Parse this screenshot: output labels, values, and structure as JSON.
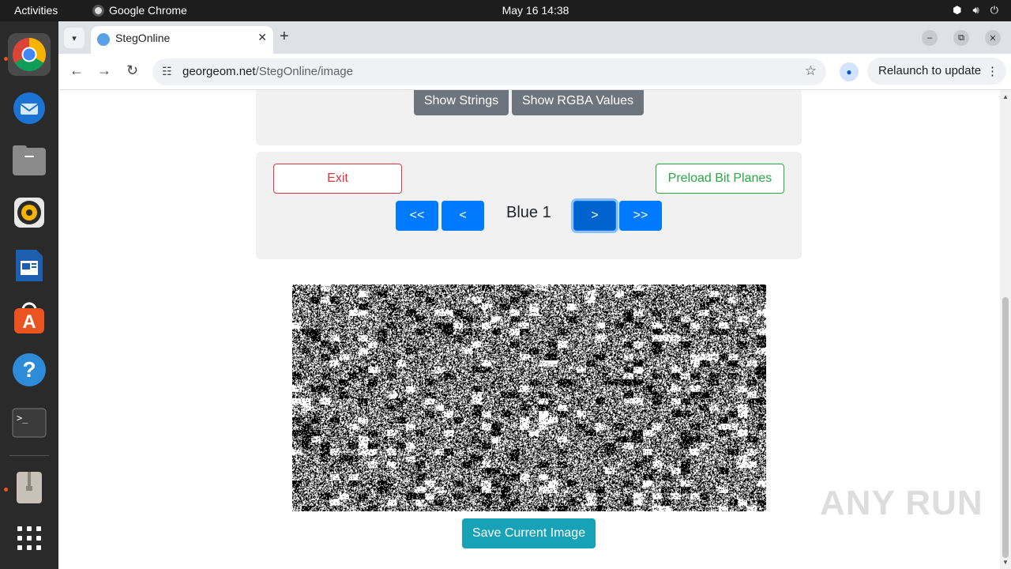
{
  "system": {
    "activities": "Activities",
    "app_name": "Google Chrome",
    "clock": "May 16  14:38"
  },
  "browser": {
    "tab_title": "StegOnline",
    "url_host": "georgeom.net",
    "url_path": "/StegOnline/image",
    "relaunch": "Relaunch to update"
  },
  "page": {
    "show_strings": "Show Strings",
    "show_rgba": "Show RGBA Values",
    "exit": "Exit",
    "preload": "Preload Bit Planes",
    "nav_first": "<<",
    "nav_prev": "<",
    "plane_label": "Blue 1",
    "nav_next": ">",
    "nav_last": ">>",
    "save": "Save Current Image"
  },
  "watermark": "ANY RUN"
}
